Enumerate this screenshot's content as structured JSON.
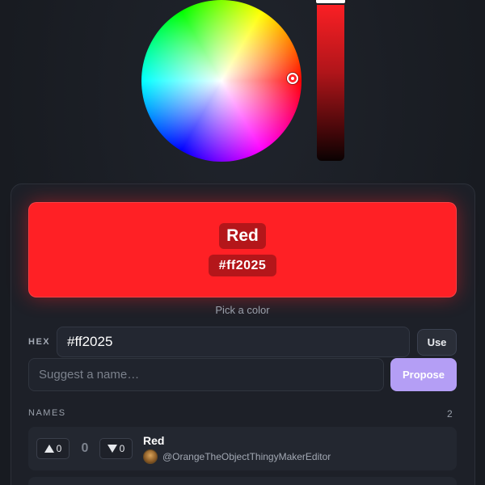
{
  "picker": {
    "wheel_icon": "color-wheel",
    "selected_color": "#ff2025",
    "brightness_level": 1.0
  },
  "swatch": {
    "name": "Red",
    "hex": "#ff2025",
    "color": "#ff2025",
    "hint": "Pick a color"
  },
  "hex_row": {
    "label": "HEX",
    "value": "#ff2025",
    "use_label": "Use"
  },
  "suggest": {
    "placeholder": "Suggest a name…",
    "propose_label": "Propose",
    "propose_color": "#b49ef5"
  },
  "names": {
    "label": "NAMES",
    "count": "2",
    "items": [
      {
        "upvotes": "0",
        "score": "0",
        "downvotes": "0",
        "name": "Red",
        "author": "@OrangeTheObjectThingyMakerEditor"
      }
    ]
  }
}
